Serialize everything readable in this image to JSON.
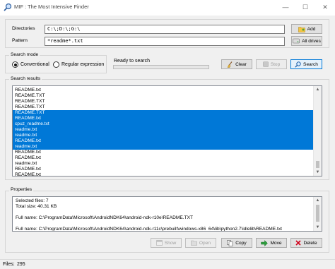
{
  "window": {
    "title": "MIF : The Most Intensive Finder",
    "min_glyph": "—",
    "max_glyph": "☐",
    "close_glyph": "✕"
  },
  "form": {
    "directories_label": "Directories",
    "directories_value": "C:\\;D:\\;G:\\",
    "pattern_label": "Pattern",
    "pattern_value": "*readme*.txt",
    "add_label": "Add",
    "all_drives_label": "All drives"
  },
  "search_mode": {
    "title": "Search mode",
    "conventional": "Conventional",
    "regular_expression": "Regular expression",
    "status": "Ready to search",
    "progress": 0,
    "clear_label": "Clear",
    "stop_label": "Stop",
    "search_label": "Search"
  },
  "results": {
    "title": "Search results",
    "rows": [
      {
        "name": "README.txt",
        "selected": false
      },
      {
        "name": "README.TXT",
        "selected": false
      },
      {
        "name": "README.TXT",
        "selected": false
      },
      {
        "name": "README.TXT",
        "selected": false
      },
      {
        "name": "README.TXT",
        "selected": true
      },
      {
        "name": "README.txt",
        "selected": true
      },
      {
        "name": "cpuz_readme.txt",
        "selected": true
      },
      {
        "name": "readme.txt",
        "selected": true
      },
      {
        "name": "readme.txt",
        "selected": true
      },
      {
        "name": "README.txt",
        "selected": true
      },
      {
        "name": "readme.txt",
        "selected": true
      },
      {
        "name": "README.txt",
        "selected": false
      },
      {
        "name": "README.txt",
        "selected": false
      },
      {
        "name": "readme.txt",
        "selected": false
      },
      {
        "name": "README.txt",
        "selected": false
      },
      {
        "name": "README.txt",
        "selected": false
      }
    ]
  },
  "properties": {
    "title": "Properties",
    "lines": [
      "Selected files: 7",
      "Total size: 40.31 KB",
      "",
      "Full name: C:\\ProgramData\\Microsoft\\AndroidNDK64\\android-ndk-r10e\\README.TXT",
      "",
      "Full name: C:\\ProgramData\\Microsoft\\AndroidNDK64\\android-ndk-r11c\\prebuilt\\windows-x86_64\\lib\\python2.7\\idlelib\\README.txt"
    ]
  },
  "actions": {
    "show_label": "Show",
    "open_label": "Open",
    "copy_label": "Copy",
    "move_label": "Move",
    "delete_label": "Delete"
  },
  "status": {
    "files_label": "Files:",
    "files_count": "295"
  },
  "colors": {
    "selection": "#0078d7",
    "accent": "#0078d7",
    "delete_red": "#d0021b",
    "move_green": "#2e9e3e"
  },
  "icons": {
    "app": "magnifier-icon",
    "add": "folder-plus-icon",
    "all_drives": "drives-icon",
    "clear": "broom-icon",
    "stop": "stop-icon",
    "search": "search-icon",
    "show": "window-icon",
    "open": "open-icon",
    "copy": "copy-icon",
    "move": "move-icon",
    "delete": "delete-icon"
  }
}
